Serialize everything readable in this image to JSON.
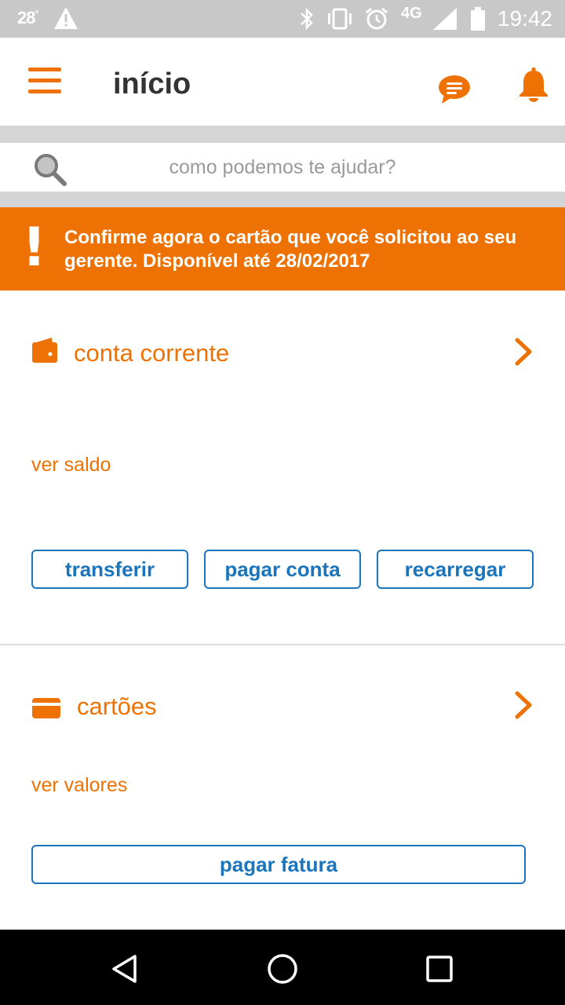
{
  "status_bar": {
    "temperature": "28",
    "temperature_unit": "°",
    "network": "4G",
    "time": "19:42",
    "icons": [
      "warning-icon",
      "bluetooth-icon",
      "vibrate-icon",
      "alarm-icon",
      "signal-icon",
      "battery-icon"
    ]
  },
  "header": {
    "title": "início",
    "icons": [
      "menu-icon",
      "chat-icon",
      "bell-icon"
    ]
  },
  "search": {
    "placeholder": "como podemos te ajudar?"
  },
  "alert": {
    "mark": "!",
    "message": "Confirme agora o cartão que você solicitou ao seu gerente. Disponível até 28/02/2017"
  },
  "checking_account": {
    "title": "conta corrente",
    "balance_link": "ver saldo",
    "actions": [
      "transferir",
      "pagar conta",
      "recarregar"
    ]
  },
  "cards": {
    "title": "cartões",
    "values_link": "ver valores",
    "action": "pagar fatura"
  },
  "colors": {
    "accent": "#ee7203",
    "button_blue": "#1b75bc",
    "status_bar": "#c8c8c8"
  }
}
